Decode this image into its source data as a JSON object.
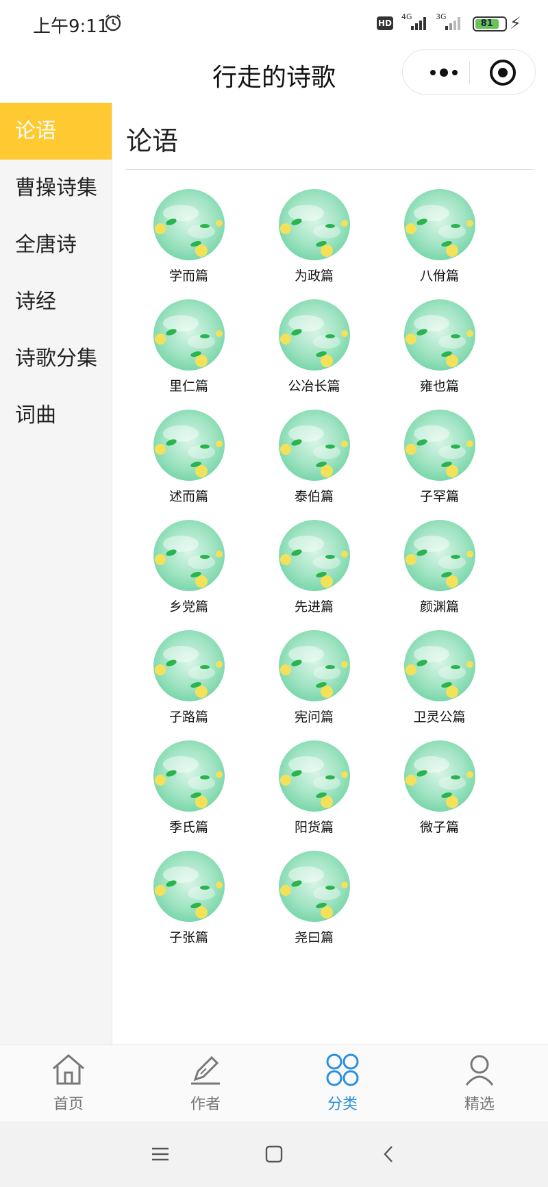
{
  "status": {
    "time": "上午9:11",
    "hd": "HD",
    "sig1": "4G",
    "sig2": "3G",
    "battery": "81"
  },
  "header": {
    "title": "行走的诗歌"
  },
  "sidebar": {
    "items": [
      {
        "label": "论语"
      },
      {
        "label": "曹操诗集"
      },
      {
        "label": "全唐诗"
      },
      {
        "label": "诗经"
      },
      {
        "label": "诗歌分集"
      },
      {
        "label": "词曲"
      }
    ]
  },
  "content": {
    "title": "论语",
    "items": [
      "学而篇",
      "为政篇",
      "八佾篇",
      "里仁篇",
      "公冶长篇",
      "雍也篇",
      "述而篇",
      "泰伯篇",
      "子罕篇",
      "乡党篇",
      "先进篇",
      "颜渊篇",
      "子路篇",
      "宪问篇",
      "卫灵公篇",
      "季氏篇",
      "阳货篇",
      "微子篇",
      "子张篇",
      "尧曰篇"
    ]
  },
  "tabbar": {
    "tabs": [
      {
        "label": "首页",
        "icon": "home-icon"
      },
      {
        "label": "作者",
        "icon": "pen-icon"
      },
      {
        "label": "分类",
        "icon": "category-icon"
      },
      {
        "label": "精选",
        "icon": "user-icon"
      }
    ],
    "active_color": "#2a8fe0"
  },
  "colors": {
    "sidebar_active": "#ffc931"
  }
}
